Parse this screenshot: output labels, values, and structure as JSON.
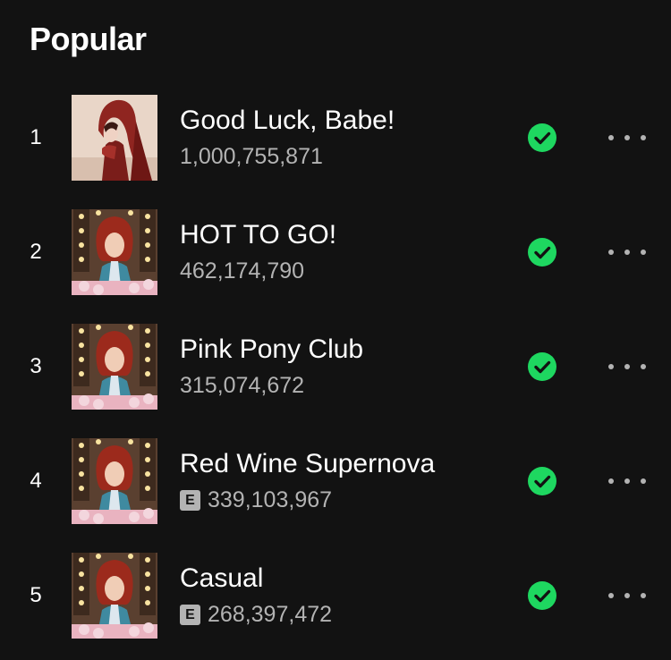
{
  "section": {
    "title": "Popular"
  },
  "colors": {
    "accent": "#1ed760",
    "background": "#121212",
    "secondary_text": "#b3b3b3"
  },
  "tracks": [
    {
      "rank": "1",
      "title": "Good Luck, Babe!",
      "plays": "1,000,755,871",
      "explicit": false,
      "explicit_label": "",
      "saved": true,
      "cover": "red-hood-portrait"
    },
    {
      "rank": "2",
      "title": "HOT TO GO!",
      "plays": "462,174,790",
      "explicit": false,
      "explicit_label": "",
      "saved": true,
      "cover": "vanity-mirror-portrait"
    },
    {
      "rank": "3",
      "title": "Pink Pony Club",
      "plays": "315,074,672",
      "explicit": false,
      "explicit_label": "",
      "saved": true,
      "cover": "vanity-mirror-portrait"
    },
    {
      "rank": "4",
      "title": "Red Wine Supernova",
      "plays": "339,103,967",
      "explicit": true,
      "explicit_label": "E",
      "saved": true,
      "cover": "vanity-mirror-portrait"
    },
    {
      "rank": "5",
      "title": "Casual",
      "plays": "268,397,472",
      "explicit": true,
      "explicit_label": "E",
      "saved": true,
      "cover": "vanity-mirror-portrait"
    }
  ]
}
